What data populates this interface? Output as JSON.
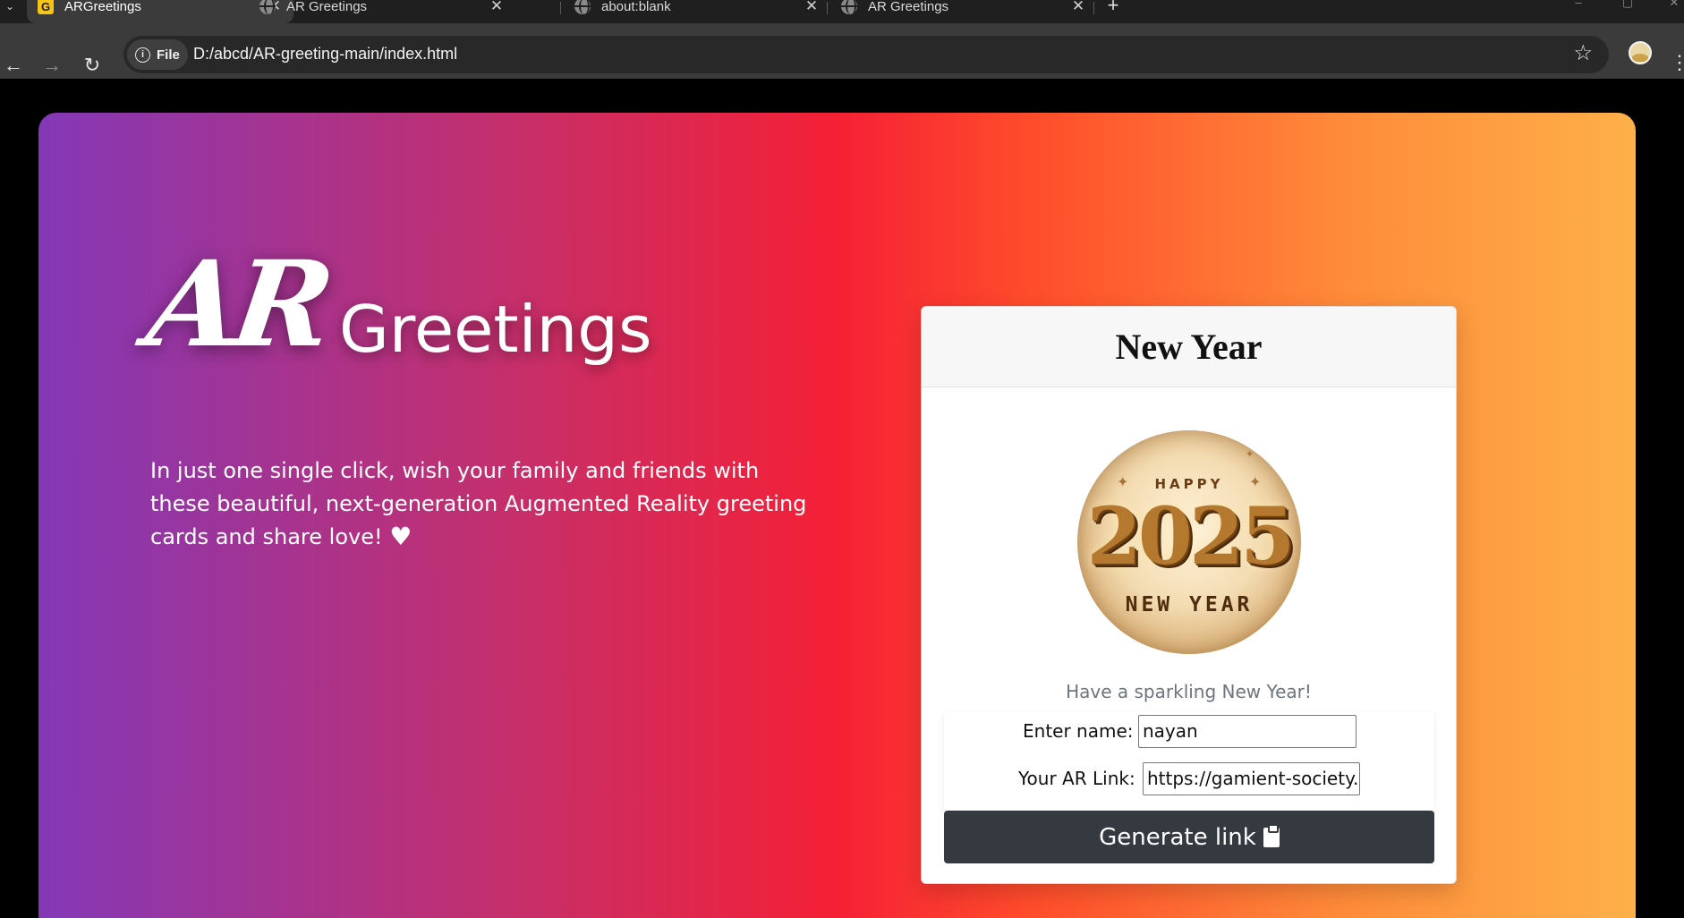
{
  "browser": {
    "tabs": [
      {
        "title": "ARGreetings",
        "favicon": "g-favicon-icon",
        "active": true
      },
      {
        "title": "AR Greetings",
        "favicon": "globe-icon",
        "active": false
      },
      {
        "title": "about:blank",
        "favicon": "globe-icon",
        "active": false
      },
      {
        "title": "AR Greetings",
        "favicon": "globe-icon",
        "active": false
      }
    ],
    "close_glyph": "✕",
    "new_tab_glyph": "+",
    "back_glyph": "←",
    "forward_glyph": "→",
    "reload_glyph": "↻",
    "site_chip_label": "File",
    "url": "D:/abcd/AR-greeting-main/index.html",
    "bookmark_glyph": "☆",
    "menu_glyph": "⋮"
  },
  "page": {
    "logo_ar": "AR",
    "logo_word": "Greetings",
    "tagline": "In just one single click, wish your family and friends with these beautiful, next-generation Augmented Reality greeting cards and share love!",
    "heart_glyph": "♥",
    "card": {
      "title": "New Year",
      "image": {
        "happy": "HAPPY",
        "year": "2025",
        "new_year": "NEW YEAR"
      },
      "subtitle": "Have a sparkling New Year!",
      "name_label": "Enter name:",
      "name_value": "nayan",
      "link_label": "Your AR Link:",
      "link_value": "https://gamient-society.",
      "generate_label": "Generate link"
    }
  },
  "colors": {
    "gradient_start": "#8438b7",
    "gradient_mid": "#f52035",
    "gradient_end": "#fdb049",
    "button_bg": "#343a40",
    "subtitle_text": "#6c757d"
  }
}
